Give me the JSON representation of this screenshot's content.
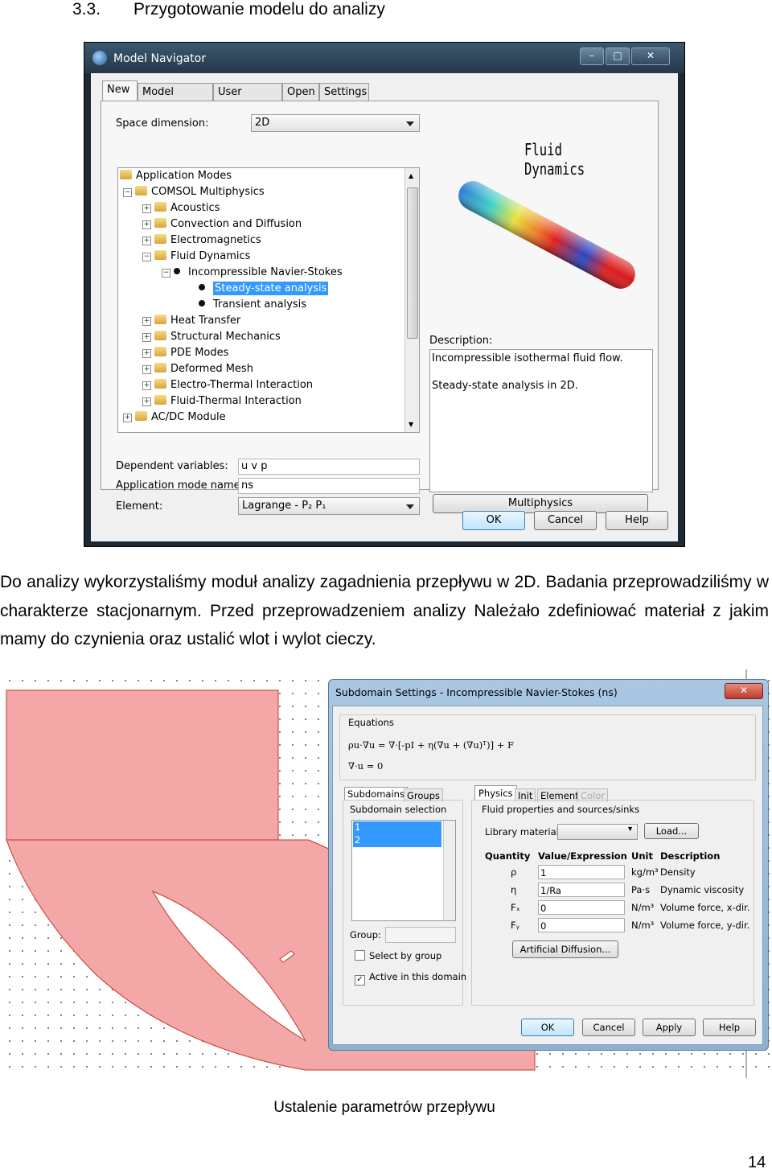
{
  "section": {
    "number": "3.3.",
    "title": "Przygotowanie modelu do analizy"
  },
  "navigator": {
    "window_title": "Model Navigator",
    "window_buttons": {
      "minimize": "–",
      "maximize": "□",
      "close": "✕"
    },
    "tabs": [
      "New",
      "Model Library",
      "User Models",
      "Open",
      "Settings"
    ],
    "space_dimension_label": "Space dimension:",
    "space_dimension_value": "2D",
    "tree": [
      {
        "label": "Application Modes"
      },
      {
        "label": "COMSOL Multiphysics"
      },
      {
        "label": "Acoustics"
      },
      {
        "label": "Convection and Diffusion"
      },
      {
        "label": "Electromagnetics"
      },
      {
        "label": "Fluid Dynamics"
      },
      {
        "label": "Incompressible Navier-Stokes"
      },
      {
        "label": "Steady-state analysis"
      },
      {
        "label": "Transient analysis"
      },
      {
        "label": "Heat Transfer"
      },
      {
        "label": "Structural Mechanics"
      },
      {
        "label": "PDE Modes"
      },
      {
        "label": "Deformed Mesh"
      },
      {
        "label": "Electro-Thermal Interaction"
      },
      {
        "label": "Fluid-Thermal Interaction"
      },
      {
        "label": "AC/DC Module"
      }
    ],
    "preview_title": "Fluid Dynamics",
    "description_label": "Description:",
    "description_line1": "Incompressible isothermal fluid flow.",
    "description_line2": "Steady-state analysis in 2D.",
    "dependent_variables_label": "Dependent variables:",
    "dependent_variables_value": "u v p",
    "app_mode_name_label": "Application mode name:",
    "app_mode_name_value": "ns",
    "element_label": "Element:",
    "element_value": "Lagrange - P₂ P₁",
    "multiphysics_button": "Multiphysics",
    "ok_button": "OK",
    "cancel_button": "Cancel",
    "help_button": "Help"
  },
  "paragraph": "Do analizy wykorzystaliśmy moduł analizy zagadnienia przepływu w 2D. Badania przeprowadziliśmy w charakterze stacjonarnym. Przed przeprowadzeniem analizy Należało zdefiniować materiał z jakim mamy do czynienia oraz ustalić wlot i wylot cieczy.",
  "subdomain": {
    "window_title": "Subdomain Settings - Incompressible Navier-Stokes (ns)",
    "close": "✕",
    "equations_label": "Equations",
    "equation1": "ρu·∇u = ∇·[-pI + η(∇u + (∇u)ᵀ)] + F",
    "equation2": "∇·u = 0",
    "left_tabs": [
      "Subdomains",
      "Groups"
    ],
    "subdomain_selection_label": "Subdomain selection",
    "subdomain_items": [
      "1",
      "2"
    ],
    "group_label": "Group:",
    "select_by_group": "Select by group",
    "active_in_domain": "Active in this domain",
    "right_tabs": [
      "Physics",
      "Init",
      "Element",
      "Color"
    ],
    "fluid_props_label": "Fluid properties and sources/sinks",
    "library_material_label": "Library material:",
    "load_button": "Load...",
    "table_headers": [
      "Quantity",
      "Value/Expression",
      "Unit",
      "Description"
    ],
    "rows": [
      {
        "q": "ρ",
        "v": "1",
        "u": "kg/m³",
        "d": "Density"
      },
      {
        "q": "η",
        "v": "1/Ra",
        "u": "Pa·s",
        "d": "Dynamic viscosity"
      },
      {
        "q": "Fₓ",
        "v": "0",
        "u": "N/m³",
        "d": "Volume force, x-dir."
      },
      {
        "q": "Fᵧ",
        "v": "0",
        "u": "N/m³",
        "d": "Volume force, y-dir."
      }
    ],
    "artificial_diffusion": "Artificial Diffusion...",
    "ok_button": "OK",
    "cancel_button": "Cancel",
    "apply_button": "Apply",
    "help_button": "Help"
  },
  "caption": "Ustalenie parametrów przepływu",
  "page_number": "14",
  "colors": {
    "geometry_fill": "#f4a7a7",
    "geometry_stroke": "#c0392b",
    "selection": "#3399ff"
  }
}
